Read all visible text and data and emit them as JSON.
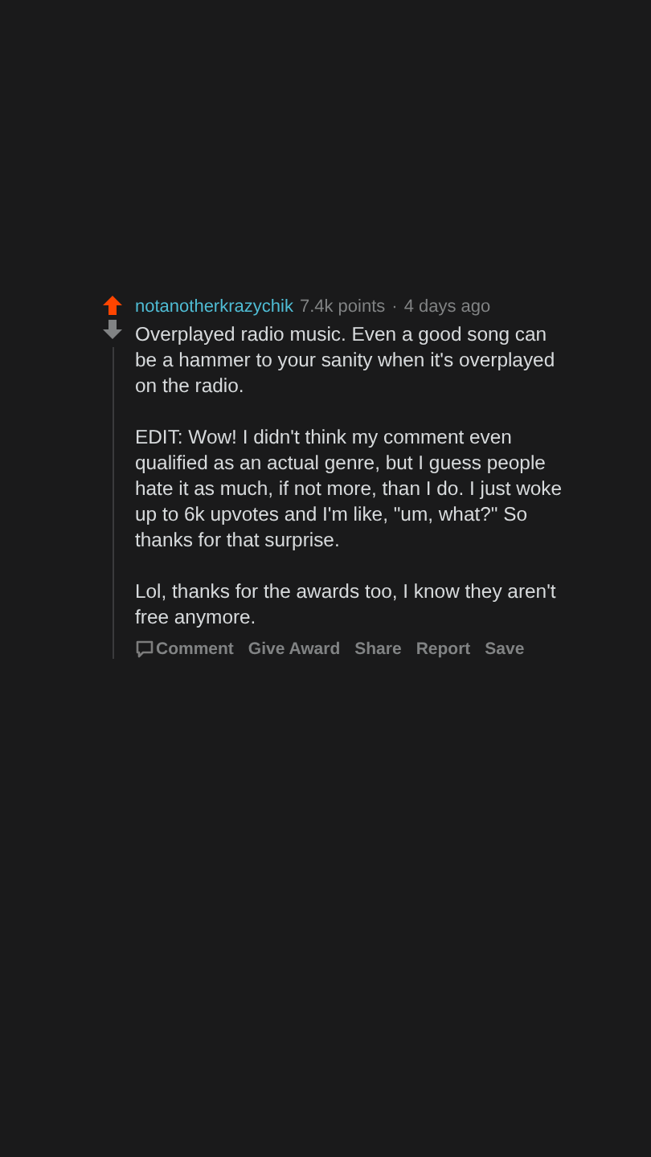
{
  "comment": {
    "upvoted": true,
    "downvoted": false,
    "author": "notanotherkrazychik",
    "points": "7.4k points",
    "separator": "·",
    "age": "4 days ago",
    "paragraphs": [
      "Overplayed radio music. Even a good song can be a hammer to your sanity when it's overplayed on the radio.",
      "EDIT: Wow! I didn't think my comment even qualified as an actual genre, but I guess people hate it as much, if not more, than I do. I just woke up to 6k upvotes and I'm like, \"um, what?\" So thanks for that surprise.",
      "Lol, thanks for the awards too, I know they aren't free anymore."
    ],
    "actions": [
      {
        "kind": "comment",
        "label": "Comment"
      },
      {
        "kind": "text",
        "label": "Give Award"
      },
      {
        "kind": "text",
        "label": "Share"
      },
      {
        "kind": "text",
        "label": "Report"
      },
      {
        "kind": "text",
        "label": "Save"
      }
    ]
  }
}
